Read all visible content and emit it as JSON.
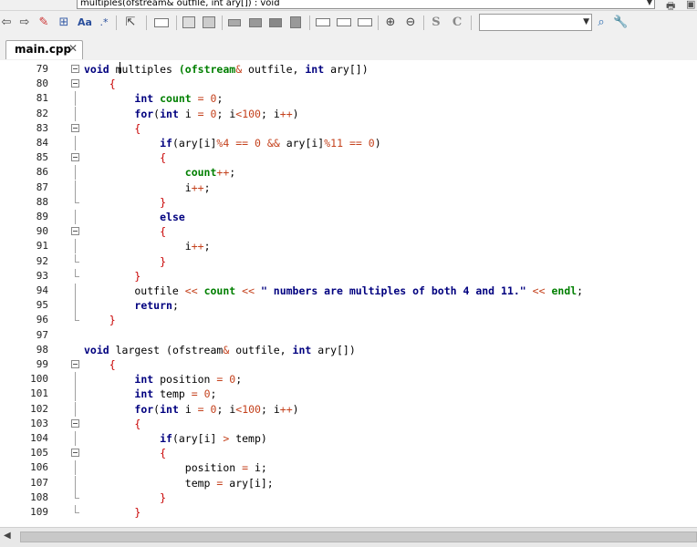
{
  "function_combo": {
    "value": "multiples(ofstream& outfile, int ary[]) : void"
  },
  "toolbar": {
    "icons": [
      "back-arrow-icon",
      "forward-arrow-icon",
      "pencil-icon",
      "insert-icon",
      "font-icon",
      "regex-icon",
      "pointer-icon",
      "rectangle-icon",
      "image-icon",
      "image-frame-icon",
      "block1-icon",
      "block2-icon",
      "block3-icon",
      "block4-icon",
      "rect1-icon",
      "rect2-icon",
      "rect3-icon",
      "zoom-in-icon",
      "zoom-out-icon",
      "s-icon",
      "c-icon",
      "search-icon",
      "wrench-icon"
    ],
    "s_label": "S",
    "c_label": "C",
    "aa_label": "Aa",
    "regex_label": ".*"
  },
  "tabs": [
    {
      "label": "main.cpp",
      "close": "✕"
    }
  ],
  "colors": {
    "keyword": "#00007f",
    "type": "#00007f",
    "number": "#c4411c",
    "operator": "#c4411c",
    "brace": "#c80000",
    "identifier_green": "#007f00",
    "string": "#00007f",
    "default": "#000000"
  },
  "editor": {
    "lines": [
      {
        "no": "79",
        "fold": "box",
        "tokens": [
          [
            "kw",
            "void"
          ],
          [
            "d",
            " multiples "
          ],
          [
            "g",
            "(ofstream"
          ],
          [
            "o",
            "&"
          ],
          [
            "d",
            " outfile, "
          ],
          [
            "kw",
            "int"
          ],
          [
            "d",
            " ary[])"
          ]
        ]
      },
      {
        "no": "80",
        "fold": "box",
        "tokens": [
          [
            "d",
            "    "
          ],
          [
            "b",
            "{"
          ]
        ]
      },
      {
        "no": "81",
        "fold": "line",
        "tokens": [
          [
            "d",
            "        "
          ],
          [
            "kw",
            "int"
          ],
          [
            "d",
            " "
          ],
          [
            "g",
            "count"
          ],
          [
            "d",
            " "
          ],
          [
            "o",
            "="
          ],
          [
            "d",
            " "
          ],
          [
            "n",
            "0"
          ],
          [
            "d",
            ";"
          ]
        ]
      },
      {
        "no": "82",
        "fold": "line",
        "tokens": [
          [
            "d",
            "        "
          ],
          [
            "kw",
            "for"
          ],
          [
            "d",
            "("
          ],
          [
            "kw",
            "int"
          ],
          [
            "d",
            " i "
          ],
          [
            "o",
            "="
          ],
          [
            "d",
            " "
          ],
          [
            "n",
            "0"
          ],
          [
            "d",
            "; i"
          ],
          [
            "o",
            "<"
          ],
          [
            "n",
            "100"
          ],
          [
            "d",
            "; i"
          ],
          [
            "o",
            "++"
          ],
          [
            "d",
            ")"
          ]
        ]
      },
      {
        "no": "83",
        "fold": "box",
        "tokens": [
          [
            "d",
            "        "
          ],
          [
            "b",
            "{"
          ]
        ]
      },
      {
        "no": "84",
        "fold": "line",
        "tokens": [
          [
            "d",
            "            "
          ],
          [
            "kw",
            "if"
          ],
          [
            "d",
            "(ary[i]"
          ],
          [
            "o",
            "%"
          ],
          [
            "n",
            "4"
          ],
          [
            "d",
            " "
          ],
          [
            "o",
            "=="
          ],
          [
            "d",
            " "
          ],
          [
            "n",
            "0"
          ],
          [
            "d",
            " "
          ],
          [
            "o",
            "&&"
          ],
          [
            "d",
            " ary[i]"
          ],
          [
            "o",
            "%"
          ],
          [
            "n",
            "11"
          ],
          [
            "d",
            " "
          ],
          [
            "o",
            "=="
          ],
          [
            "d",
            " "
          ],
          [
            "n",
            "0"
          ],
          [
            "d",
            ")"
          ]
        ]
      },
      {
        "no": "85",
        "fold": "box",
        "tokens": [
          [
            "d",
            "            "
          ],
          [
            "b",
            "{"
          ]
        ]
      },
      {
        "no": "86",
        "fold": "line",
        "tokens": [
          [
            "d",
            "                "
          ],
          [
            "g",
            "count"
          ],
          [
            "o",
            "++"
          ],
          [
            "d",
            ";"
          ]
        ]
      },
      {
        "no": "87",
        "fold": "line",
        "tokens": [
          [
            "d",
            "                i"
          ],
          [
            "o",
            "++"
          ],
          [
            "d",
            ";"
          ]
        ]
      },
      {
        "no": "88",
        "fold": "end",
        "tokens": [
          [
            "d",
            "            "
          ],
          [
            "b",
            "}"
          ]
        ]
      },
      {
        "no": "89",
        "fold": "line",
        "tokens": [
          [
            "d",
            "            "
          ],
          [
            "kw",
            "else"
          ]
        ]
      },
      {
        "no": "90",
        "fold": "box",
        "tokens": [
          [
            "d",
            "            "
          ],
          [
            "b",
            "{"
          ]
        ]
      },
      {
        "no": "91",
        "fold": "line",
        "tokens": [
          [
            "d",
            "                i"
          ],
          [
            "o",
            "++"
          ],
          [
            "d",
            ";"
          ]
        ]
      },
      {
        "no": "92",
        "fold": "end",
        "tokens": [
          [
            "d",
            "            "
          ],
          [
            "b",
            "}"
          ]
        ]
      },
      {
        "no": "93",
        "fold": "end",
        "tokens": [
          [
            "d",
            "        "
          ],
          [
            "b",
            "}"
          ]
        ]
      },
      {
        "no": "94",
        "fold": "line",
        "tokens": [
          [
            "d",
            "        outfile "
          ],
          [
            "o",
            "<<"
          ],
          [
            "d",
            " "
          ],
          [
            "g",
            "count"
          ],
          [
            "d",
            " "
          ],
          [
            "o",
            "<<"
          ],
          [
            "d",
            " "
          ],
          [
            "s",
            "\" numbers are multiples of both 4 and 11.\""
          ],
          [
            "d",
            " "
          ],
          [
            "o",
            "<<"
          ],
          [
            "d",
            " "
          ],
          [
            "g",
            "endl"
          ],
          [
            "d",
            ";"
          ]
        ]
      },
      {
        "no": "95",
        "fold": "line",
        "tokens": [
          [
            "d",
            "        "
          ],
          [
            "kw",
            "return"
          ],
          [
            "d",
            ";"
          ]
        ]
      },
      {
        "no": "96",
        "fold": "end",
        "tokens": [
          [
            "d",
            "    "
          ],
          [
            "b",
            "}"
          ]
        ]
      },
      {
        "no": "97",
        "fold": "none",
        "tokens": []
      },
      {
        "no": "98",
        "fold": "none",
        "tokens": [
          [
            "kw",
            "void"
          ],
          [
            "d",
            " largest (ofstream"
          ],
          [
            "o",
            "&"
          ],
          [
            "d",
            " outfile, "
          ],
          [
            "kw",
            "int"
          ],
          [
            "d",
            " ary[])"
          ]
        ]
      },
      {
        "no": "99",
        "fold": "box",
        "tokens": [
          [
            "d",
            "    "
          ],
          [
            "b",
            "{"
          ]
        ]
      },
      {
        "no": "100",
        "fold": "line",
        "tokens": [
          [
            "d",
            "        "
          ],
          [
            "kw",
            "int"
          ],
          [
            "d",
            " position "
          ],
          [
            "o",
            "="
          ],
          [
            "d",
            " "
          ],
          [
            "n",
            "0"
          ],
          [
            "d",
            ";"
          ]
        ]
      },
      {
        "no": "101",
        "fold": "line",
        "tokens": [
          [
            "d",
            "        "
          ],
          [
            "kw",
            "int"
          ],
          [
            "d",
            " temp "
          ],
          [
            "o",
            "="
          ],
          [
            "d",
            " "
          ],
          [
            "n",
            "0"
          ],
          [
            "d",
            ";"
          ]
        ]
      },
      {
        "no": "102",
        "fold": "line",
        "tokens": [
          [
            "d",
            "        "
          ],
          [
            "kw",
            "for"
          ],
          [
            "d",
            "("
          ],
          [
            "kw",
            "int"
          ],
          [
            "d",
            " i "
          ],
          [
            "o",
            "="
          ],
          [
            "d",
            " "
          ],
          [
            "n",
            "0"
          ],
          [
            "d",
            "; i"
          ],
          [
            "o",
            "<"
          ],
          [
            "n",
            "100"
          ],
          [
            "d",
            "; i"
          ],
          [
            "o",
            "++"
          ],
          [
            "d",
            ")"
          ]
        ]
      },
      {
        "no": "103",
        "fold": "box",
        "tokens": [
          [
            "d",
            "        "
          ],
          [
            "b",
            "{"
          ]
        ]
      },
      {
        "no": "104",
        "fold": "line",
        "tokens": [
          [
            "d",
            "            "
          ],
          [
            "kw",
            "if"
          ],
          [
            "d",
            "(ary[i] "
          ],
          [
            "o",
            ">"
          ],
          [
            "d",
            " temp)"
          ]
        ]
      },
      {
        "no": "105",
        "fold": "box",
        "tokens": [
          [
            "d",
            "            "
          ],
          [
            "b",
            "{"
          ]
        ]
      },
      {
        "no": "106",
        "fold": "line",
        "tokens": [
          [
            "d",
            "                position "
          ],
          [
            "o",
            "="
          ],
          [
            "d",
            " i;"
          ]
        ]
      },
      {
        "no": "107",
        "fold": "line",
        "tokens": [
          [
            "d",
            "                temp "
          ],
          [
            "o",
            "="
          ],
          [
            "d",
            " ary[i];"
          ]
        ]
      },
      {
        "no": "108",
        "fold": "end",
        "tokens": [
          [
            "d",
            "            "
          ],
          [
            "b",
            "}"
          ]
        ]
      },
      {
        "no": "109",
        "fold": "end",
        "tokens": [
          [
            "d",
            "        "
          ],
          [
            "b",
            "}"
          ]
        ]
      }
    ]
  }
}
